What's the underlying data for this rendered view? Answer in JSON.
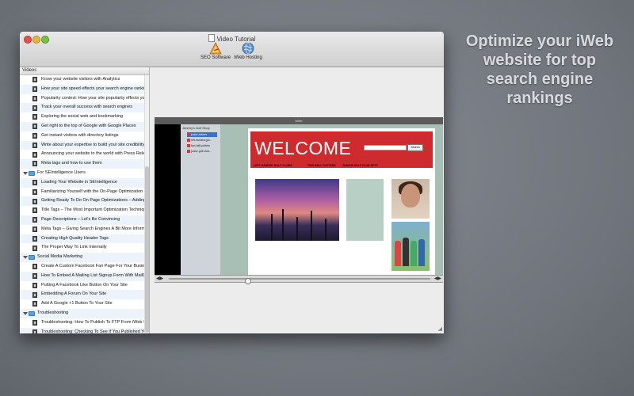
{
  "promo": {
    "lines": [
      "Optimize your iWeb",
      "website for top",
      "search engine",
      "rankings"
    ]
  },
  "window": {
    "title": "Video Tutorial",
    "toolbar": [
      {
        "label": "SEO Software",
        "icon": "seo-software-icon"
      },
      {
        "label": "iWeb Hosting",
        "icon": "globe-icon"
      }
    ]
  },
  "sidebar": {
    "header": "Videos",
    "rows": [
      {
        "type": "item",
        "label": "Know your website visitors with Analytics"
      },
      {
        "type": "item",
        "label": "How your site speed effects your search engine rankings"
      },
      {
        "type": "item",
        "label": "Popularity contest: How your site popularity effects you..."
      },
      {
        "type": "item",
        "label": "Track your overall success with search engines"
      },
      {
        "type": "item",
        "label": "Exploring the social web and bookmarking"
      },
      {
        "type": "item",
        "label": "Get right to the top of Google with Google Places"
      },
      {
        "type": "item",
        "label": "Get instant visitors with directory listings"
      },
      {
        "type": "item",
        "label": "Write about your expertise to build your site credibility"
      },
      {
        "type": "item",
        "label": "Announcing your website to the world with Press Relea..."
      },
      {
        "type": "item",
        "label": "Meta tags and how to use them"
      },
      {
        "type": "group",
        "label": "For SEIntelligence Users"
      },
      {
        "type": "item",
        "label": "Loading Your Website in SEIntelligence"
      },
      {
        "type": "item",
        "label": "Familiarizing Yourself with the On-Page Optimization ..."
      },
      {
        "type": "item",
        "label": "Getting Ready To Do On Page Optimizations – Adding ..."
      },
      {
        "type": "item",
        "label": "Title Tags – The Most Important Optimization Technique"
      },
      {
        "type": "item",
        "label": "Page Descriptions – Let's Be Convincing"
      },
      {
        "type": "item",
        "label": "Meta Tags – Giving Search Engines A Bit More Informat..."
      },
      {
        "type": "item",
        "label": "Creating High Quality Header Tags"
      },
      {
        "type": "item",
        "label": "The Proper Way To Link Internally"
      },
      {
        "type": "group",
        "label": "Social Media Marketing"
      },
      {
        "type": "item",
        "label": "Create A Custom Facebook Fan Page For Your Business"
      },
      {
        "type": "item",
        "label": "How To Embed A Mailing List Signup Form With MailCh..."
      },
      {
        "type": "item",
        "label": "Putting A Facebook Like Button On Your Site"
      },
      {
        "type": "item",
        "label": "Embedding A Forum On Your Site"
      },
      {
        "type": "item",
        "label": "Add A Google +1 Button To Your Site"
      },
      {
        "type": "group",
        "label": "Troubleshooting"
      },
      {
        "type": "item",
        "label": "Troubleshooting: How To Publish To FTP From iWeb SE..."
      },
      {
        "type": "item",
        "label": "Troubleshooting: Checking To See If You Published Yo..."
      }
    ]
  },
  "player": {
    "progress": 0.29,
    "iweb": {
      "window_title": "iWeb",
      "site_name": "Jeremy's Golf Shop",
      "pages": [
        "junior-drivers",
        "left-handed-gol...",
        "two-ball-putters",
        "junior-golf-club..."
      ],
      "selected_page": 0,
      "welcome": "WELCOME",
      "search_button": "Search",
      "nav": [
        "LEFT HANDED GOLF CLUBS",
        "TWO BALL PUTTERS",
        "JUNIOR GOLF CLUB SETS"
      ]
    }
  }
}
